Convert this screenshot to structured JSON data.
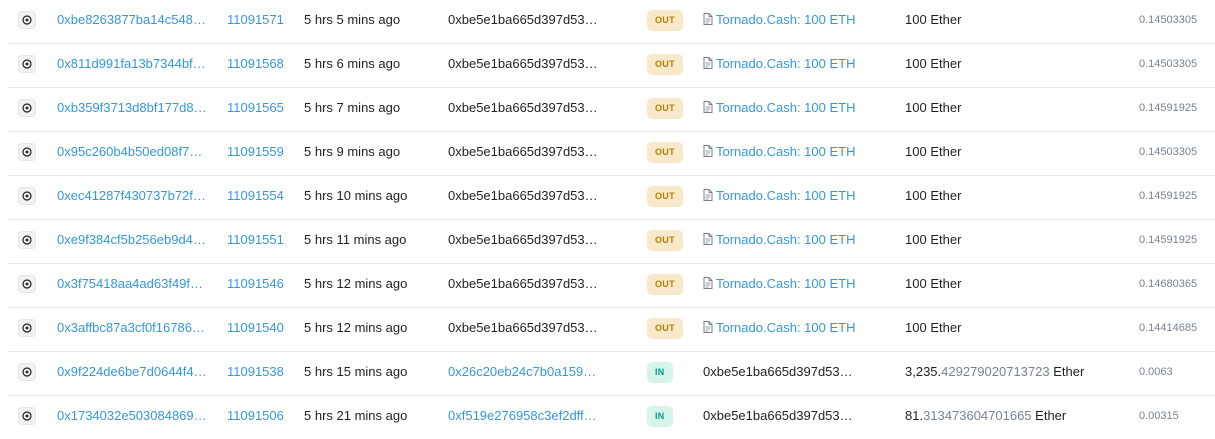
{
  "colors": {
    "link": "#3498db",
    "out_badge_bg": "#f7e8c9",
    "out_badge_text": "#b47d00",
    "in_badge_bg": "#d6f3ec",
    "in_badge_text": "#00a186",
    "divider": "#e7eaf3"
  },
  "rows": [
    {
      "icon": "eye-icon",
      "hash": "0xbe8263877ba14c548…",
      "block": "11091571",
      "age": "5 hrs 5 mins ago",
      "from": "0xbe5e1ba665d397d53…",
      "direction": "OUT",
      "to_icon": "contract-icon",
      "to": "Tornado.Cash: 100 ETH",
      "value_int": "100",
      "value_dec": "",
      "value_unit": "Ether",
      "fee": "0.14503305"
    },
    {
      "icon": "eye-icon",
      "hash": "0x811d991fa13b7344bf…",
      "block": "11091568",
      "age": "5 hrs 6 mins ago",
      "from": "0xbe5e1ba665d397d53…",
      "direction": "OUT",
      "to_icon": "contract-icon",
      "to": "Tornado.Cash: 100 ETH",
      "value_int": "100",
      "value_dec": "",
      "value_unit": "Ether",
      "fee": "0.14503305"
    },
    {
      "icon": "eye-icon",
      "hash": "0xb359f3713d8bf177d8…",
      "block": "11091565",
      "age": "5 hrs 7 mins ago",
      "from": "0xbe5e1ba665d397d53…",
      "direction": "OUT",
      "to_icon": "contract-icon",
      "to": "Tornado.Cash: 100 ETH",
      "value_int": "100",
      "value_dec": "",
      "value_unit": "Ether",
      "fee": "0.14591925"
    },
    {
      "icon": "eye-icon",
      "hash": "0x95c260b4b50ed08f7…",
      "block": "11091559",
      "age": "5 hrs 9 mins ago",
      "from": "0xbe5e1ba665d397d53…",
      "direction": "OUT",
      "to_icon": "contract-icon",
      "to": "Tornado.Cash: 100 ETH",
      "value_int": "100",
      "value_dec": "",
      "value_unit": "Ether",
      "fee": "0.14503305"
    },
    {
      "icon": "eye-icon",
      "hash": "0xec41287f430737b72f…",
      "block": "11091554",
      "age": "5 hrs 10 mins ago",
      "from": "0xbe5e1ba665d397d53…",
      "direction": "OUT",
      "to_icon": "contract-icon",
      "to": "Tornado.Cash: 100 ETH",
      "value_int": "100",
      "value_dec": "",
      "value_unit": "Ether",
      "fee": "0.14591925"
    },
    {
      "icon": "eye-icon",
      "hash": "0xe9f384cf5b256eb9d4…",
      "block": "11091551",
      "age": "5 hrs 11 mins ago",
      "from": "0xbe5e1ba665d397d53…",
      "direction": "OUT",
      "to_icon": "contract-icon",
      "to": "Tornado.Cash: 100 ETH",
      "value_int": "100",
      "value_dec": "",
      "value_unit": "Ether",
      "fee": "0.14591925"
    },
    {
      "icon": "eye-icon",
      "hash": "0x3f75418aa4ad63f49f…",
      "block": "11091546",
      "age": "5 hrs 12 mins ago",
      "from": "0xbe5e1ba665d397d53…",
      "direction": "OUT",
      "to_icon": "contract-icon",
      "to": "Tornado.Cash: 100 ETH",
      "value_int": "100",
      "value_dec": "",
      "value_unit": "Ether",
      "fee": "0.14680365"
    },
    {
      "icon": "eye-icon",
      "hash": "0x3affbc87a3cf0f16786…",
      "block": "11091540",
      "age": "5 hrs 12 mins ago",
      "from": "0xbe5e1ba665d397d53…",
      "direction": "OUT",
      "to_icon": "contract-icon",
      "to": "Tornado.Cash: 100 ETH",
      "value_int": "100",
      "value_dec": "",
      "value_unit": "Ether",
      "fee": "0.14414685"
    },
    {
      "icon": "eye-icon",
      "hash": "0x9f224de6be7d0644f4…",
      "block": "11091538",
      "age": "5 hrs 15 mins ago",
      "from": "0x26c20eb24c7b0a159…",
      "direction": "IN",
      "to_icon": "",
      "to": "0xbe5e1ba665d397d53…",
      "value_int": "3,235.",
      "value_dec": "429279020713723",
      "value_unit": "Ether",
      "fee": "0.0063"
    },
    {
      "icon": "eye-icon",
      "hash": "0x1734032e503084869…",
      "block": "11091506",
      "age": "5 hrs 21 mins ago",
      "from": "0xf519e276958c3ef2dff…",
      "direction": "IN",
      "to_icon": "",
      "to": "0xbe5e1ba665d397d53…",
      "value_int": "81.",
      "value_dec": "313473604701665",
      "value_unit": "Ether",
      "fee": "0.00315"
    }
  ]
}
